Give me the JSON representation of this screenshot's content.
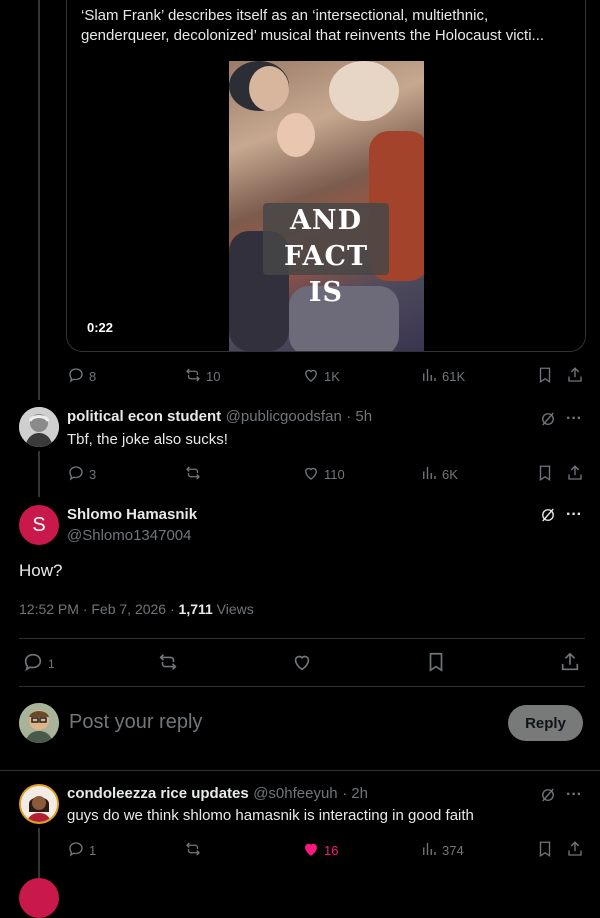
{
  "quoted_media": {
    "caption": "‘Slam Frank’ describes itself as an ‘intersectional, multiethnic, genderqueer, decolonized’ musical that reinvents the Holocaust victi...",
    "overlay_text": "AND FACT IS",
    "duration": "0:22"
  },
  "post1_actions": {
    "replies": "8",
    "reposts": "10",
    "likes": "1K",
    "views": "61K"
  },
  "reply1": {
    "name": "political econ student",
    "handle": "@publicgoodsfan",
    "time": "· 5h",
    "text": "Tbf, the joke also sucks!",
    "actions": {
      "replies": "3",
      "reposts": "",
      "likes": "110",
      "views": "6K"
    }
  },
  "main_post": {
    "avatar_letter": "S",
    "name": "Shlomo Hamasnik",
    "handle": "@Shlomo1347004",
    "text": "How?",
    "timestamp": "12:52 PM · Feb 7, 2026 · ",
    "views_count": "1,711",
    "views_label": " Views",
    "actions": {
      "replies": "1"
    },
    "accent_color": "#c9184a"
  },
  "reply_composer": {
    "placeholder": "Post your reply",
    "button_label": "Reply"
  },
  "reply2": {
    "name": "condoleezza rice updates",
    "handle": "@s0hfeeyuh",
    "time": "· 2h",
    "text": "guys do we think shlomo hamasnik is interacting in good faith",
    "actions": {
      "replies": "1",
      "reposts": "",
      "likes": "16",
      "views": "374"
    },
    "liked_color": "#f91880"
  }
}
